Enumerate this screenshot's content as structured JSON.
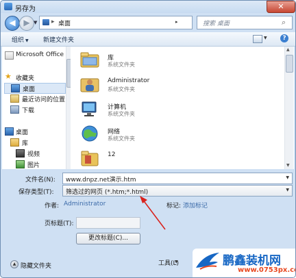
{
  "window": {
    "title": "另存为",
    "close_glyph": "✕"
  },
  "nav": {
    "back_glyph": "◀",
    "forward_glyph": "▶",
    "address_sep": "▸",
    "address_text": "桌面",
    "address_arrow": "▸",
    "refresh_glyph": "↻",
    "search_placeholder": "搜索 桌面",
    "search_glyph": "⌕"
  },
  "toolbar": {
    "organize": "组织",
    "new_folder": "新建文件夹",
    "help_glyph": "?"
  },
  "sidebar": {
    "items": [
      {
        "label": "Microsoft Office",
        "icon": "document-icon"
      },
      {
        "label": "收藏夹",
        "icon": "star-icon"
      },
      {
        "label": "桌面",
        "icon": "desktop-icon"
      },
      {
        "label": "最近访问的位置",
        "icon": "recent-places-icon"
      },
      {
        "label": "下载",
        "icon": "downloads-icon"
      },
      {
        "label": "桌面",
        "icon": "desktop-icon"
      },
      {
        "label": "库",
        "icon": "library-icon"
      },
      {
        "label": "视频",
        "icon": "video-icon"
      },
      {
        "label": "图片",
        "icon": "pictures-icon"
      }
    ]
  },
  "files": [
    {
      "name": "库",
      "type": "系统文件夹",
      "icon": "library-folder-icon"
    },
    {
      "name": "Administrator",
      "type": "系统文件夹",
      "icon": "user-folder-icon"
    },
    {
      "name": "计算机",
      "type": "系统文件夹",
      "icon": "computer-icon"
    },
    {
      "name": "网络",
      "type": "系统文件夹",
      "icon": "network-icon"
    },
    {
      "name": "12",
      "type": "",
      "icon": "folder-icon"
    }
  ],
  "form": {
    "filename_label": "文件名(N):",
    "filename_value": "www.dnpz.net演示.htm",
    "filetype_label": "保存类型(T):",
    "filetype_value": "筛选过的网页 (*.htm;*.html)",
    "author_label": "作者:",
    "author_value": "Administrator",
    "tags_label": "标记:",
    "tags_value": "添加标记",
    "pagetitle_label": "页标题(T):",
    "pagetitle_value": "",
    "change_title_button": "更改标题(C)..."
  },
  "footer": {
    "hide_folders": "隐藏文件夹",
    "tools": "工具(L)",
    "caret": "▼"
  },
  "watermark": {
    "brand": "鹏鑫装机网",
    "url": "www.0753px.com"
  },
  "colors": {
    "accent": "#1767c4",
    "annotation_arrow": "#d9221c",
    "window_frame": "#cfe0f3"
  }
}
